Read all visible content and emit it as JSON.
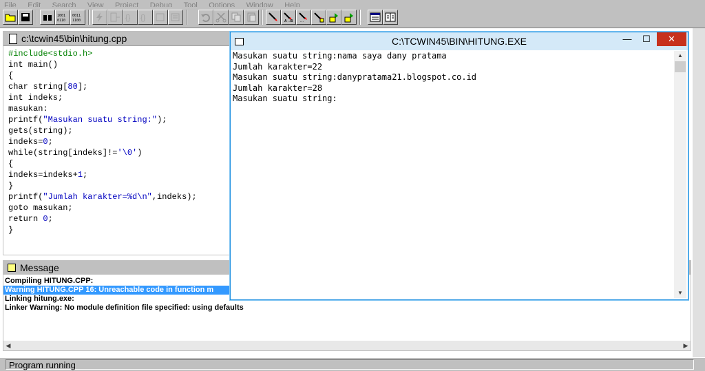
{
  "menu": [
    "File",
    "Edit",
    "Search",
    "View",
    "Project",
    "Debug",
    "Tool",
    "Options",
    "Window",
    "Help"
  ],
  "editor": {
    "title": "c:\\tcwin45\\bin\\hitung.cpp",
    "lines": [
      "#include<stdio.h>",
      "int main()",
      "{",
      "char string[80];",
      "int indeks;",
      "masukan:",
      "printf(\"Masukan suatu string:\");",
      "gets(string);",
      "indeks=0;",
      "while(string[indeks]!='\\0')",
      "{",
      "indeks=indeks+1;",
      "}",
      "printf(\"Jumlah karakter=%d\\n\",indeks);",
      "goto masukan;",
      "return 0;",
      "}"
    ]
  },
  "message": {
    "title": "Message",
    "lines": [
      "Compiling HITUNG.CPP:",
      "Warning HITUNG.CPP 16: Unreachable code in function m",
      "Linking hitung.exe:",
      "Linker Warning: No module definition file specified: using defaults"
    ]
  },
  "console": {
    "title": "C:\\TCWIN45\\BIN\\HITUNG.EXE",
    "minimize": "—",
    "maximize": "☐",
    "close": "✕",
    "lines": [
      "Masukan suatu string:nama saya dany pratama",
      "Jumlah karakter=22",
      "Masukan suatu string:danypratama21.blogspot.co.id",
      "Jumlah karakter=28",
      "Masukan suatu string:"
    ]
  },
  "status": {
    "text": "Program running"
  },
  "colors": {
    "selection": "#3399ff",
    "close_button": "#c7311d",
    "string_literal": "#0000c0",
    "preprocessor": "#008000"
  }
}
